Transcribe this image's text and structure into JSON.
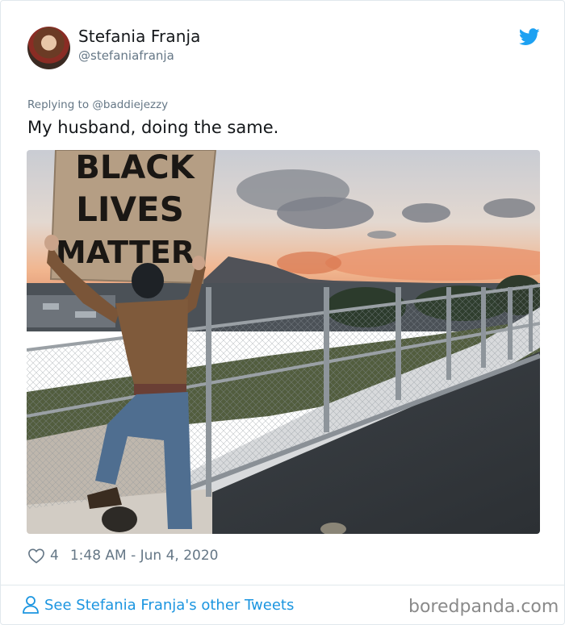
{
  "tweet": {
    "author_name": "Stefania Franja",
    "author_handle": "@stefaniafranja",
    "replying_to": "Replying to @baddiejezzy",
    "text": "My husband, doing the same.",
    "likes": "4",
    "timestamp": "1:48 AM - Jun 4, 2020"
  },
  "photo": {
    "sign_line1": "BLACK",
    "sign_line2": "LIVES",
    "sign_line3": "MATTER"
  },
  "footer": {
    "other_tweets_link": "See Stefania Franja's other Tweets",
    "watermark": "boredpanda.com"
  },
  "colors": {
    "twitter_blue": "#1da1f2",
    "link_blue": "#1b95e0",
    "secondary_text": "#657786"
  },
  "icons": [
    "twitter-bird-icon",
    "heart-icon",
    "person-icon"
  ]
}
